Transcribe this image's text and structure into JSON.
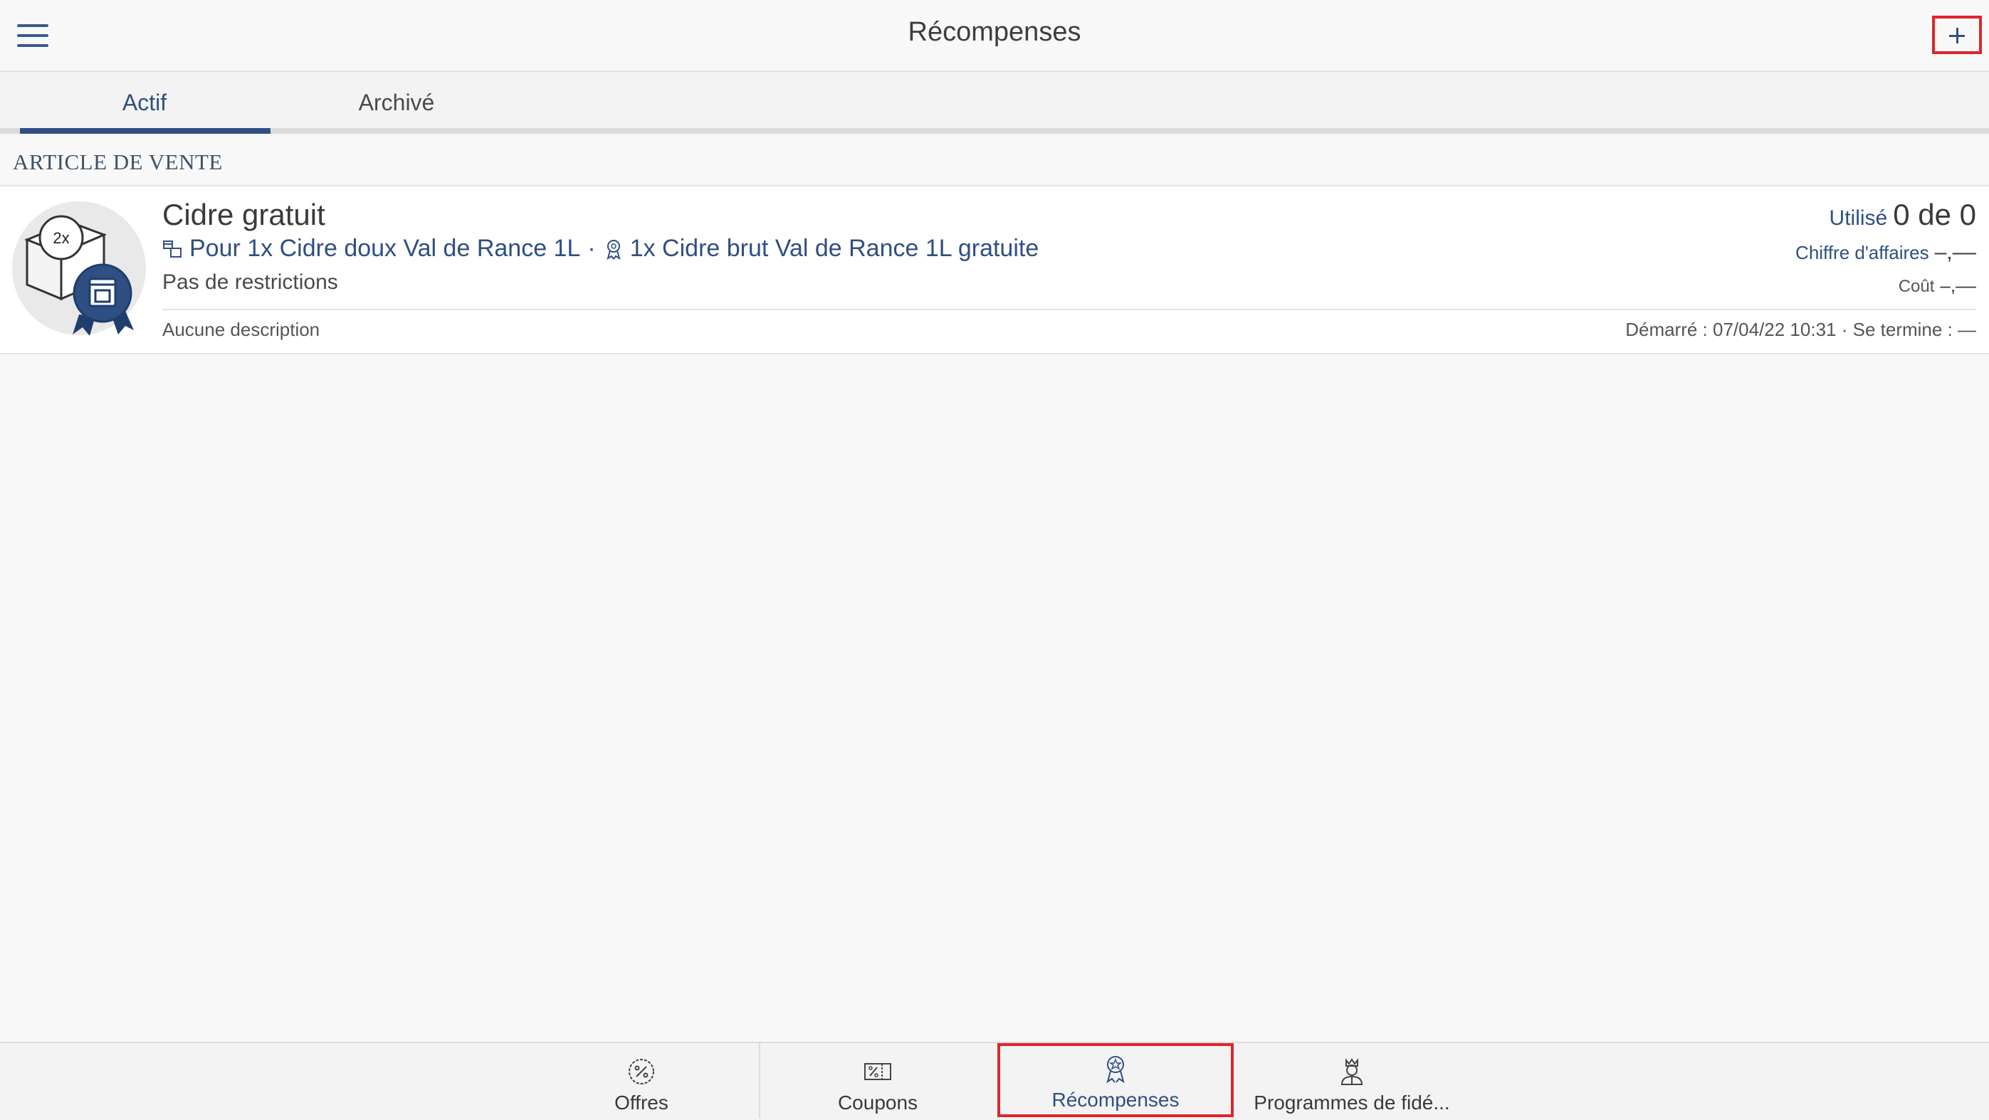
{
  "header": {
    "title": "Récompenses",
    "menu_icon": "hamburger-menu-icon",
    "add_icon": "plus-icon"
  },
  "tabs": [
    {
      "label": "Actif",
      "active": true
    },
    {
      "label": "Archivé",
      "active": false
    }
  ],
  "section": {
    "title": "ARTICLE DE VENTE"
  },
  "reward_item": {
    "badge_text": "2x",
    "title": "Cidre gratuit",
    "condition_icon": "boxes-icon",
    "condition": "Pour 1x Cidre doux Val de Rance 1L",
    "separator": "·",
    "reward_icon": "award-ribbon-icon",
    "reward": "1x Cidre brut Val de Rance 1L gratuite",
    "restrictions": "Pas de restrictions",
    "description": "Aucune description",
    "used_label": "Utilisé",
    "used_value": "0 de 0",
    "revenue_label": "Chiffre d'affaires",
    "revenue_value": "–,––",
    "cost_label": "Coût",
    "cost_value": "–,––",
    "dates": "Démarré : 07/04/22 10:31 · Se termine : —"
  },
  "bottom_nav": [
    {
      "label": "Offres",
      "icon": "percent-badge-icon",
      "active": false
    },
    {
      "label": "Coupons",
      "icon": "coupon-icon",
      "active": false
    },
    {
      "label": "Récompenses",
      "icon": "award-ribbon-icon",
      "active": true
    },
    {
      "label": "Programmes de fidé...",
      "icon": "loyalty-person-icon",
      "active": false
    }
  ],
  "colors": {
    "accent": "#2f4f82",
    "highlight": "#e0252b",
    "background": "#f8f8f8"
  }
}
